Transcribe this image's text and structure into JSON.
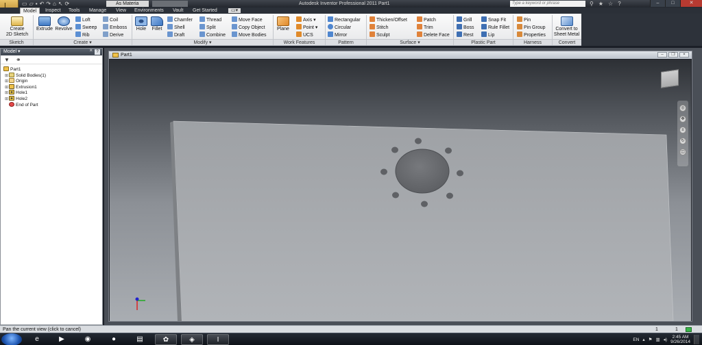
{
  "app": {
    "title": "Autodesk Inventor Professional 2011    Part1",
    "material": "As Materia",
    "search_placeholder": "Type a keyword or phrase"
  },
  "tabs": [
    "Model",
    "Inspect",
    "Tools",
    "Manage",
    "View",
    "Environments",
    "Vault",
    "Get Started"
  ],
  "ribbon": {
    "sketch": {
      "create_label": "Create\n2D Sketch",
      "panel": "Sketch"
    },
    "create": {
      "extrude": "Extrude",
      "revolve": "Revolve",
      "loft": "Loft",
      "sweep": "Sweep",
      "rib": "Rib",
      "coil": "Coil",
      "emboss": "Emboss",
      "derive": "Derive",
      "panel": "Create"
    },
    "modify": {
      "hole": "Hole",
      "fillet": "Fillet",
      "chamfer": "Chamfer",
      "shell": "Shell",
      "draft": "Draft",
      "thread": "Thread",
      "split": "Split",
      "combine": "Combine",
      "move_face": "Move Face",
      "copy_object": "Copy Object",
      "move_bodies": "Move Bodies",
      "panel": "Modify"
    },
    "work_features": {
      "plane": "Plane",
      "axis": "Axis",
      "point": "Point",
      "ucs": "UCS",
      "panel": "Work Features"
    },
    "pattern": {
      "rectangular": "Rectangular",
      "circular": "Circular",
      "mirror": "Mirror",
      "panel": "Pattern"
    },
    "surface": {
      "thicken": "Thicken/Offset",
      "stitch": "Stitch",
      "sculpt": "Sculpt",
      "patch": "Patch",
      "trim": "Trim",
      "delete_face": "Delete Face",
      "panel": "Surface"
    },
    "plastic": {
      "grill": "Grill",
      "boss": "Boss",
      "rest": "Rest",
      "snap_fit": "Snap Fit",
      "rule_fillet": "Rule Fillet",
      "lip": "Lip",
      "panel": "Plastic Part"
    },
    "harness": {
      "pin": "Pin",
      "pin_group": "Pin Group",
      "properties": "Properties",
      "panel": "Harness"
    },
    "convert": {
      "label": "Convert to\nSheet Metal",
      "panel": "Convert"
    }
  },
  "browser": {
    "title": "Model",
    "tree": [
      {
        "label": "Part1",
        "icon": "part-icon",
        "level": 0
      },
      {
        "label": "Solid Bodies(1)",
        "icon": "solid-bodies-icon",
        "level": 1
      },
      {
        "label": "Origin",
        "icon": "folder-icon",
        "level": 1
      },
      {
        "label": "Extrusion1",
        "icon": "extrusion-icon",
        "level": 1
      },
      {
        "label": "Hole1",
        "icon": "hole-icon",
        "level": 1
      },
      {
        "label": "Hole2",
        "icon": "hole-icon",
        "level": 1
      },
      {
        "label": "End of Part",
        "icon": "end-of-part-icon",
        "level": 1
      }
    ]
  },
  "document": {
    "title": "Part1"
  },
  "status": {
    "text": "Pan the current view (click to cancel)",
    "count1": "1",
    "count2": "1"
  },
  "taskbar": {
    "apps": [
      "internet-explorer-icon",
      "media-player-icon",
      "firefox-icon",
      "app-icon",
      "file-explorer-icon",
      "app-icon-2",
      "app-icon-3",
      "inventor-icon"
    ],
    "language": "EN",
    "time": "2:45 AM",
    "date": "9/26/2014"
  },
  "colors": {
    "accent": "#f0c24a",
    "ribbon": "#eef0f2",
    "status_green": "#39b54a"
  }
}
